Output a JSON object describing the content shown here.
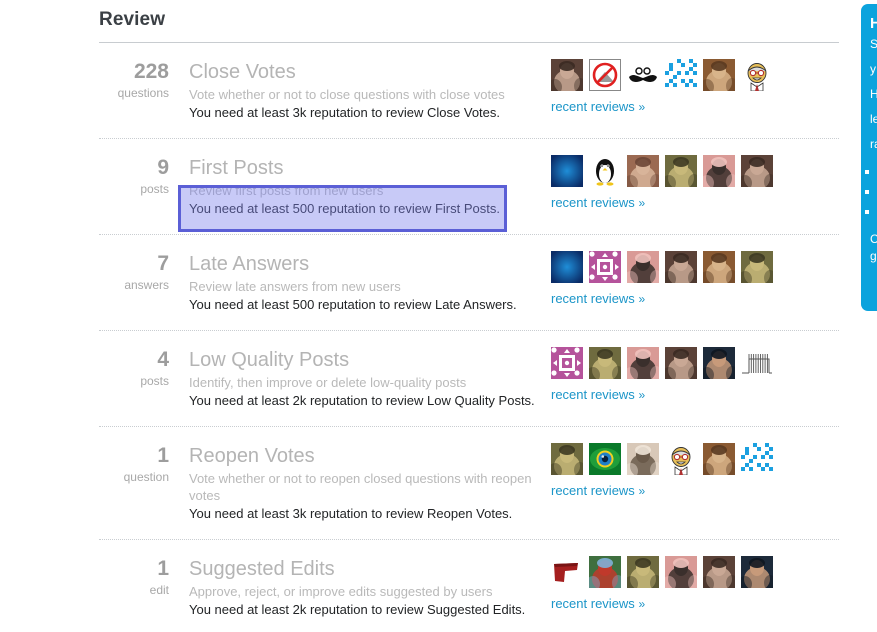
{
  "page": {
    "title": "Review"
  },
  "reviews": [
    {
      "count": "228",
      "count_label": "questions",
      "name": "Close Votes",
      "description": "Vote whether or not to close questions with close votes",
      "requirement": "You need at least 3k reputation to review Close Votes.",
      "recent_link": "recent reviews",
      "recent_chevron": "»",
      "avatars": [
        {
          "name": "avatar-photo-woman-curly",
          "kind": "photo",
          "colors": [
            "#5b4238",
            "#c9a895",
            "#3a2a22"
          ]
        },
        {
          "name": "avatar-no-swimming-sign",
          "kind": "icon-nosign",
          "colors": [
            "#ffffff",
            "#e02020",
            "#888888"
          ]
        },
        {
          "name": "avatar-moustache",
          "kind": "icon-moustache",
          "colors": [
            "#ffffff",
            "#111111"
          ]
        },
        {
          "name": "avatar-identicon-blue",
          "kind": "identicon",
          "colors": [
            "#ffffff",
            "#1ba0e0"
          ]
        },
        {
          "name": "avatar-photo-cat",
          "kind": "photo",
          "colors": [
            "#8a5a32",
            "#d8b48a",
            "#5a3a20"
          ]
        },
        {
          "name": "avatar-cartoon-face-glasses",
          "kind": "icon-cartoon",
          "colors": [
            "#ffffff",
            "#e8c05a",
            "#b03030"
          ]
        }
      ]
    },
    {
      "count": "9",
      "count_label": "posts",
      "name": "First Posts",
      "description": "Review first posts from new users",
      "requirement": "You need at least 500 reputation to review First Posts.",
      "recent_link": "recent reviews",
      "recent_chevron": "»",
      "avatars": [
        {
          "name": "avatar-blue-radial",
          "kind": "radial",
          "colors": [
            "#0a2b66",
            "#1f8ed8"
          ]
        },
        {
          "name": "avatar-penguin",
          "kind": "icon-penguin",
          "colors": [
            "#ffffff",
            "#111111",
            "#f0c419"
          ]
        },
        {
          "name": "avatar-photo-man-brick",
          "kind": "photo",
          "colors": [
            "#9b6a52",
            "#d8b49a",
            "#6b4636"
          ]
        },
        {
          "name": "avatar-photo-giraffe",
          "kind": "photo",
          "colors": [
            "#6f6b3f",
            "#c8b97a",
            "#3d3a22"
          ]
        },
        {
          "name": "avatar-photo-man-pink",
          "kind": "photo",
          "colors": [
            "#d99a96",
            "#3a2f2c",
            "#f0c2bd"
          ]
        },
        {
          "name": "avatar-photo-woman-curly",
          "kind": "photo",
          "colors": [
            "#5b4238",
            "#c9a895",
            "#3a2a22"
          ]
        }
      ]
    },
    {
      "count": "7",
      "count_label": "answers",
      "name": "Late Answers",
      "description": "Review late answers from new users",
      "requirement": "You need at least 500 reputation to review Late Answers.",
      "recent_link": "recent reviews",
      "recent_chevron": "»",
      "avatars": [
        {
          "name": "avatar-blue-radial",
          "kind": "radial",
          "colors": [
            "#0a2b66",
            "#1f8ed8"
          ]
        },
        {
          "name": "avatar-identicon-pink",
          "kind": "identicon-pink",
          "colors": [
            "#ffffff",
            "#b5539b"
          ]
        },
        {
          "name": "avatar-photo-man-pink",
          "kind": "photo",
          "colors": [
            "#d99a96",
            "#3a2f2c",
            "#f0c2bd"
          ]
        },
        {
          "name": "avatar-photo-woman-curly",
          "kind": "photo",
          "colors": [
            "#5b4238",
            "#c9a895",
            "#3a2a22"
          ]
        },
        {
          "name": "avatar-photo-cat",
          "kind": "photo",
          "colors": [
            "#8a5a32",
            "#d8b48a",
            "#5a3a20"
          ]
        },
        {
          "name": "avatar-photo-giraffe",
          "kind": "photo",
          "colors": [
            "#6f6b3f",
            "#c8b97a",
            "#3d3a22"
          ]
        }
      ]
    },
    {
      "count": "4",
      "count_label": "posts",
      "name": "Low Quality Posts",
      "description": "Identify, then improve or delete low-quality posts",
      "requirement": "You need at least 2k reputation to review Low Quality Posts.",
      "recent_link": "recent reviews",
      "recent_chevron": "»",
      "avatars": [
        {
          "name": "avatar-identicon-pink",
          "kind": "identicon-pink",
          "colors": [
            "#ffffff",
            "#b5539b"
          ]
        },
        {
          "name": "avatar-photo-giraffe",
          "kind": "photo",
          "colors": [
            "#6f6b3f",
            "#c8b97a",
            "#3d3a22"
          ]
        },
        {
          "name": "avatar-photo-man-pink",
          "kind": "photo",
          "colors": [
            "#d99a96",
            "#3a2f2c",
            "#f0c2bd"
          ]
        },
        {
          "name": "avatar-photo-woman-curly",
          "kind": "photo",
          "colors": [
            "#5b4238",
            "#c9a895",
            "#3a2a22"
          ]
        },
        {
          "name": "avatar-photo-man-cap",
          "kind": "photo",
          "colors": [
            "#1d2a3a",
            "#c79a7a",
            "#0f1620"
          ]
        },
        {
          "name": "avatar-spike-train-plot",
          "kind": "plot",
          "colors": [
            "#ffffff",
            "#555555"
          ]
        }
      ]
    },
    {
      "count": "1",
      "count_label": "question",
      "name": "Reopen Votes",
      "description": "Vote whether or not to reopen closed questions with reopen votes",
      "requirement": "You need at least 3k reputation to review Reopen Votes.",
      "recent_link": "recent reviews",
      "recent_chevron": "»",
      "avatars": [
        {
          "name": "avatar-photo-giraffe",
          "kind": "photo",
          "colors": [
            "#6f6b3f",
            "#c8b97a",
            "#3d3a22"
          ]
        },
        {
          "name": "avatar-green-eye",
          "kind": "eye",
          "colors": [
            "#0a7a2a",
            "#1f9e3a",
            "#f0d020"
          ]
        },
        {
          "name": "avatar-photo-glasses",
          "kind": "photo",
          "colors": [
            "#d8c8b8",
            "#6a5a4a",
            "#f0e4d8"
          ]
        },
        {
          "name": "avatar-cartoon-face-glasses",
          "kind": "icon-cartoon",
          "colors": [
            "#ffffff",
            "#e8c05a",
            "#b03030"
          ]
        },
        {
          "name": "avatar-photo-cat",
          "kind": "photo",
          "colors": [
            "#8a5a32",
            "#d8b48a",
            "#5a3a20"
          ]
        },
        {
          "name": "avatar-identicon-blue",
          "kind": "identicon",
          "colors": [
            "#ffffff",
            "#1ba0e0"
          ]
        }
      ]
    },
    {
      "count": "1",
      "count_label": "edit",
      "name": "Suggested Edits",
      "description": "Approve, reject, or improve edits suggested by users",
      "requirement": "You need at least 2k reputation to review Suggested Edits.",
      "recent_link": "recent reviews",
      "recent_chevron": "»",
      "avatars": [
        {
          "name": "avatar-red-shape",
          "kind": "redshape",
          "colors": [
            "#ffffff",
            "#a51f1f",
            "#7a1414"
          ]
        },
        {
          "name": "avatar-photo-man-lake",
          "kind": "photo",
          "colors": [
            "#3f6f3f",
            "#c0392b",
            "#7fb0d8"
          ]
        },
        {
          "name": "avatar-photo-giraffe",
          "kind": "photo",
          "colors": [
            "#6f6b3f",
            "#c8b97a",
            "#3d3a22"
          ]
        },
        {
          "name": "avatar-photo-man-pink",
          "kind": "photo",
          "colors": [
            "#d99a96",
            "#3a2f2c",
            "#f0c2bd"
          ]
        },
        {
          "name": "avatar-photo-woman-curly",
          "kind": "photo",
          "colors": [
            "#5b4238",
            "#c9a895",
            "#3a2a22"
          ]
        },
        {
          "name": "avatar-photo-man-cap",
          "kind": "photo",
          "colors": [
            "#1d2a3a",
            "#c79a7a",
            "#0f1620"
          ]
        }
      ]
    }
  ],
  "side_panel": {
    "title": "H",
    "line1": "S",
    "line2": "y",
    "line3": "H",
    "line4": "le",
    "line5": "ra",
    "bullet1": "",
    "bullet2": "",
    "bullet3": "",
    "foot1": "C",
    "foot2": "g",
    "bg_color": "#0ba3dd"
  },
  "highlight": {
    "border_color": "#5b5fd6",
    "fill_color": "rgba(124,128,235,0.42)"
  }
}
